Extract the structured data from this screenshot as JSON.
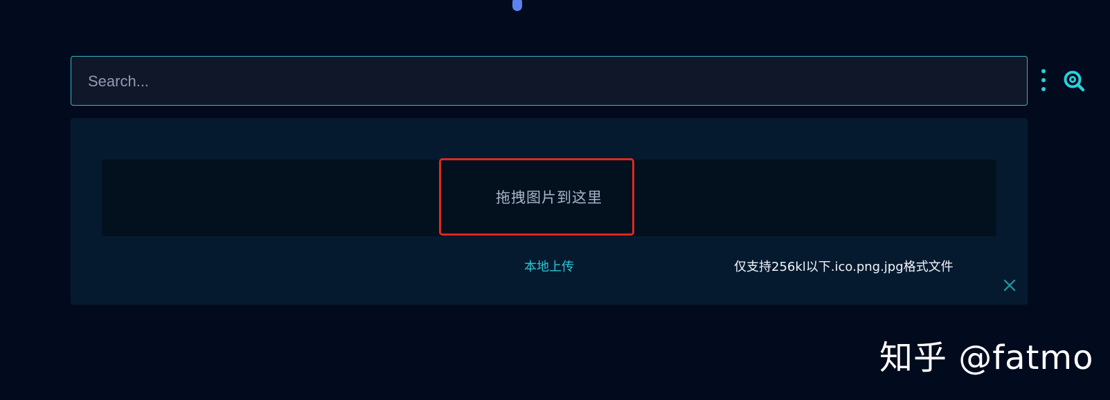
{
  "search": {
    "placeholder": "Search...",
    "value": "",
    "more_icon": "vertical-dots-icon",
    "engine_icon": "search-engine-icon"
  },
  "upload": {
    "drop_text": "拖拽图片到这里",
    "local_upload_label": "本地上传",
    "format_hint": "仅支持256kl以下.ico.png.jpg格式文件",
    "close_icon": "close-icon"
  },
  "watermark": {
    "text": "知乎 @fatmo"
  },
  "colors": {
    "background": "#020b1e",
    "accent": "#27d1dc",
    "highlight": "#e0281e",
    "panel": "#061a2f"
  }
}
